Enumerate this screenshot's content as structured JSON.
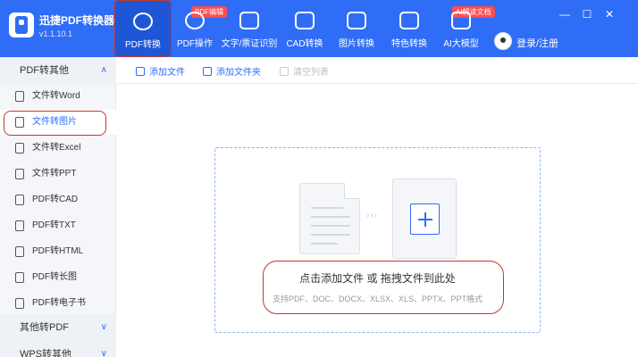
{
  "app": {
    "title": "迅捷PDF转换器",
    "version": "v1.1.10.1"
  },
  "nav": [
    {
      "label": "PDF转换",
      "badge": ""
    },
    {
      "label": "PDF操作",
      "badge": "PDF编辑"
    },
    {
      "label": "文字/票证识别",
      "badge": ""
    },
    {
      "label": "CAD转换",
      "badge": ""
    },
    {
      "label": "图片转换",
      "badge": ""
    },
    {
      "label": "特色转换",
      "badge": ""
    },
    {
      "label": "AI大模型",
      "badge": "AI解读文档"
    }
  ],
  "account": {
    "login_label": "登录/注册"
  },
  "window": {
    "minimize": "—",
    "restore": "☐",
    "close": "✕"
  },
  "sidebar": {
    "group1": "PDF转其他",
    "items": [
      "文件转Word",
      "文件转图片",
      "文件转Excel",
      "文件转PPT",
      "PDF转CAD",
      "PDF转TXT",
      "PDF转HTML",
      "PDF转长图",
      "PDF转电子书"
    ],
    "group2": "其他转PDF",
    "group3": "WPS转其他",
    "active_index": 1
  },
  "toolbar": {
    "add_file": "添加文件",
    "add_folder": "添加文件夹",
    "clear_list": "清空列表"
  },
  "dropzone": {
    "main_text": "点击添加文件 或 拖拽文件到此处",
    "sub_text": "支持PDF、DOC、DOCX、XLSX、XLS、PPTX、PPT格式"
  }
}
